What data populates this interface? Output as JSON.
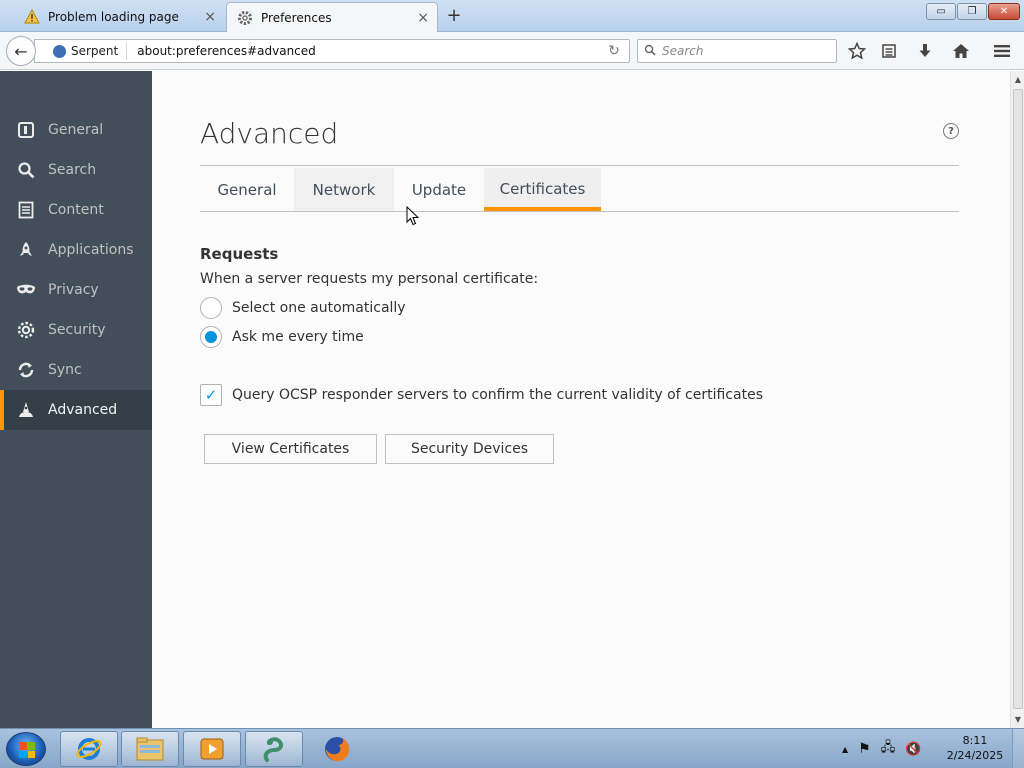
{
  "browser": {
    "tabs": [
      {
        "title": "Problem loading page",
        "icon": "warning-icon",
        "close": "×"
      },
      {
        "title": "Preferences",
        "icon": "gear-icon",
        "close": "×",
        "active": true
      }
    ],
    "new_tab": "+",
    "window_controls": {
      "minimize": "▭",
      "maximize": "❐",
      "close": "✕"
    },
    "nav": {
      "back": "←",
      "identity_label": "Serpent",
      "url": "about:preferences#advanced",
      "reload": "↻",
      "search_placeholder": "Search",
      "search_icon": "🔍"
    },
    "toolbar_icons": [
      "bookmark-star-icon",
      "bookmarks-list-icon",
      "downloads-icon",
      "home-icon",
      "menu-icon"
    ]
  },
  "sidebar": {
    "items": [
      {
        "label": "General",
        "icon": "general-icon"
      },
      {
        "label": "Search",
        "icon": "search-icon"
      },
      {
        "label": "Content",
        "icon": "content-icon"
      },
      {
        "label": "Applications",
        "icon": "applications-icon"
      },
      {
        "label": "Privacy",
        "icon": "privacy-mask-icon"
      },
      {
        "label": "Security",
        "icon": "security-icon"
      },
      {
        "label": "Sync",
        "icon": "sync-icon"
      },
      {
        "label": "Advanced",
        "icon": "advanced-icon",
        "selected": true
      }
    ]
  },
  "main": {
    "title": "Advanced",
    "help": "?",
    "tabs": [
      {
        "label": "General"
      },
      {
        "label": "Network"
      },
      {
        "label": "Update"
      },
      {
        "label": "Certificates",
        "selected": true
      }
    ],
    "requests": {
      "heading": "Requests",
      "description": "When a server requests my personal certificate:",
      "options": [
        {
          "label": "Select one automatically",
          "selected": false
        },
        {
          "label": "Ask me every time",
          "selected": true
        }
      ]
    },
    "ocsp": {
      "label": "Query OCSP responder servers to confirm the current validity of certificates",
      "checked": true,
      "check_glyph": "✓"
    },
    "buttons": {
      "view_certificates": "View Certificates",
      "security_devices": "Security Devices"
    }
  },
  "taskbar": {
    "apps": [
      "internet-explorer-icon",
      "file-explorer-icon",
      "media-player-icon",
      "serpent-browser-icon",
      "firefox-icon"
    ],
    "tray": {
      "arrow": "▲",
      "flag": "⚑",
      "network": "🖧",
      "volume": "🔇"
    },
    "clock": {
      "time": "8:11",
      "date": "2/24/2025"
    }
  },
  "colors": {
    "accent": "#ff9500",
    "sidebar_bg": "#424f5a",
    "sidebar_selected_bg": "#343f48",
    "radio_checked": "#0095dd"
  }
}
